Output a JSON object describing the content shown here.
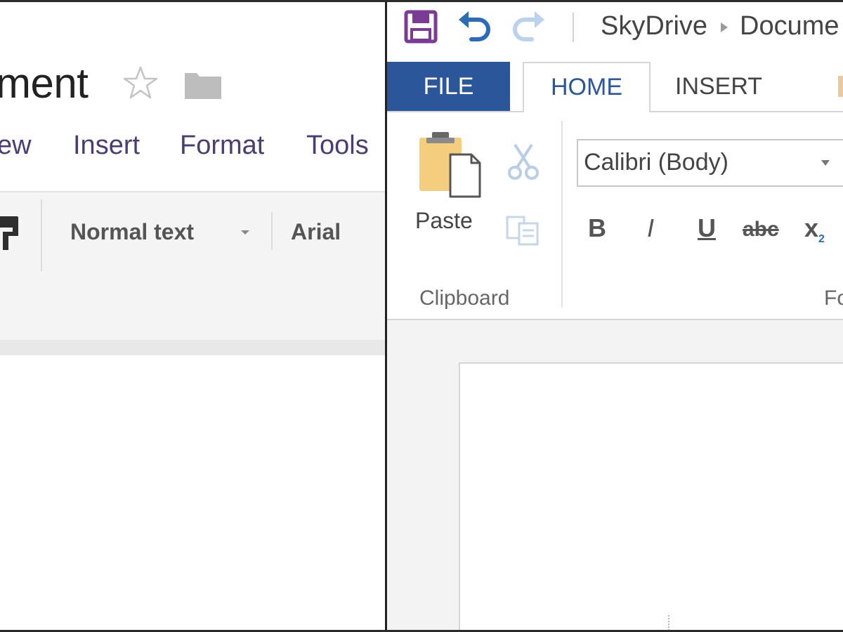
{
  "left_pane": {
    "doc_title_fragment": "ment",
    "menu": [
      "ew",
      "Insert",
      "Format",
      "Tools"
    ],
    "toolbar": {
      "style_select": "Normal text",
      "font_select": "Arial"
    }
  },
  "right_pane": {
    "breadcrumb": [
      "SkyDrive",
      "Docume"
    ],
    "tabs": {
      "file": "FILE",
      "home": "HOME",
      "insert": "INSERT"
    },
    "clipboard": {
      "paste_label": "Paste",
      "group_label": "Clipboard"
    },
    "font": {
      "font_name": "Calibri (Body)",
      "bold": "B",
      "italic": "I",
      "underline": "U",
      "strikethrough": "abc",
      "subscript_base": "x",
      "subscript_mark": "2",
      "group_label_fragment": "Fo"
    },
    "colors": {
      "accent_blue": "#2b579a",
      "save_purple": "#7b3a96",
      "undo_blue": "#2b6cb8"
    }
  },
  "icons": [
    "star-icon",
    "folder-icon",
    "paint-format-icon",
    "save-icon",
    "undo-icon",
    "redo-icon",
    "paste-icon",
    "cut-icon",
    "copy-icon"
  ]
}
